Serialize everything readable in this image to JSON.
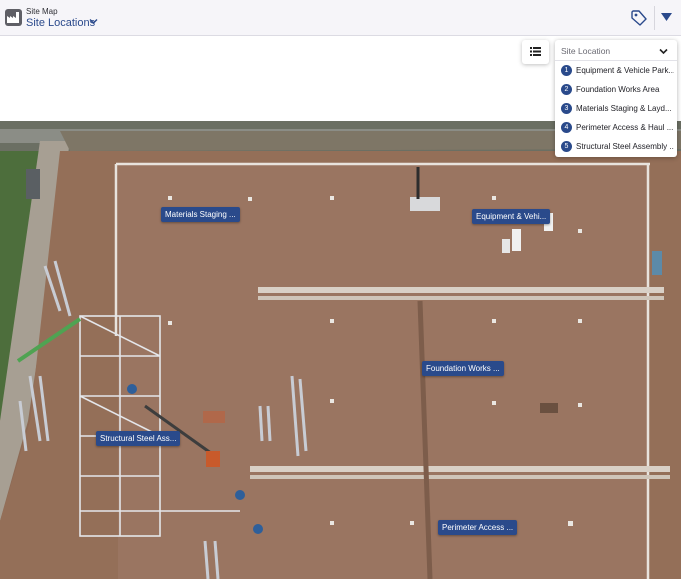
{
  "header": {
    "subtitle": "Site Map",
    "title": "Site Locations"
  },
  "panel": {
    "title": "Site Location",
    "items": [
      {
        "num": "1",
        "label": "Equipment & Vehicle Park..."
      },
      {
        "num": "2",
        "label": "Foundation Works Area"
      },
      {
        "num": "3",
        "label": "Materials Staging & Layd..."
      },
      {
        "num": "4",
        "label": "Perimeter Access & Haul ..."
      },
      {
        "num": "5",
        "label": "Structural Steel Assembly ..."
      }
    ]
  },
  "map": {
    "pins": [
      {
        "label": "Materials Staging ..."
      },
      {
        "label": "Equipment & Vehi..."
      },
      {
        "label": "Foundation Works ..."
      },
      {
        "label": "Structural Steel Ass..."
      },
      {
        "label": "Perimeter Access ..."
      }
    ]
  },
  "icons": {
    "app": "factory-icon",
    "title_dropdown": "chevron-down-icon",
    "tag": "tag-icon",
    "menu": "caret-down-icon",
    "list": "list-icon",
    "panel_dropdown": "chevron-down-icon"
  },
  "colors": {
    "accent": "#2a4a8b",
    "header_bg": "#f6f5f9",
    "soil": "#8d6a55"
  }
}
